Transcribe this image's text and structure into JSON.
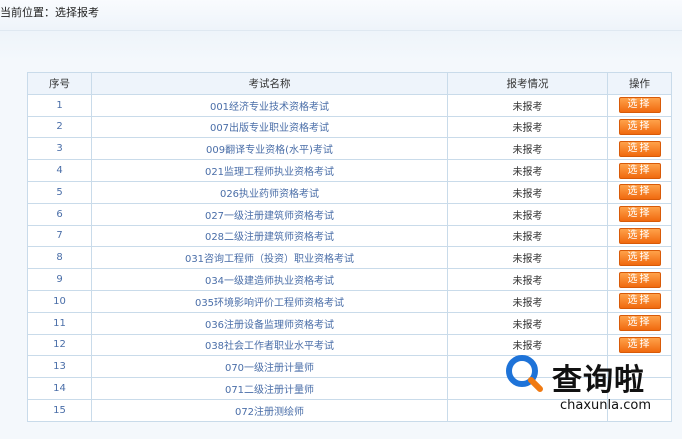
{
  "breadcrumb": "当前位置：选择报考",
  "table": {
    "headers": [
      "序号",
      "考试名称",
      "报考情况",
      "操作"
    ],
    "button_label": "选择",
    "rows": [
      {
        "no": "1",
        "name": "001经济专业技术资格考试",
        "status": "未报考",
        "action": "选择"
      },
      {
        "no": "2",
        "name": "007出版专业职业资格考试",
        "status": "未报考",
        "action": "选择"
      },
      {
        "no": "3",
        "name": "009翻译专业资格(水平)考试",
        "status": "未报考",
        "action": "选择"
      },
      {
        "no": "4",
        "name": "021监理工程师执业资格考试",
        "status": "未报考",
        "action": "选择"
      },
      {
        "no": "5",
        "name": "026执业药师资格考试",
        "status": "未报考",
        "action": "选择"
      },
      {
        "no": "6",
        "name": "027一级注册建筑师资格考试",
        "status": "未报考",
        "action": "选择"
      },
      {
        "no": "7",
        "name": "028二级注册建筑师资格考试",
        "status": "未报考",
        "action": "选择"
      },
      {
        "no": "8",
        "name": "031咨询工程师（投资）职业资格考试",
        "status": "未报考",
        "action": "选择"
      },
      {
        "no": "9",
        "name": "034一级建造师执业资格考试",
        "status": "未报考",
        "action": "选择"
      },
      {
        "no": "10",
        "name": "035环境影响评价工程师资格考试",
        "status": "未报考",
        "action": "选择"
      },
      {
        "no": "11",
        "name": "036注册设备监理师资格考试",
        "status": "未报考",
        "action": "选择"
      },
      {
        "no": "12",
        "name": "038社会工作者职业水平考试",
        "status": "未报考",
        "action": "选择"
      },
      {
        "no": "13",
        "name": "070一级注册计量师",
        "status": "",
        "action": ""
      },
      {
        "no": "14",
        "name": "071二级注册计量师",
        "status": "",
        "action": ""
      },
      {
        "no": "15",
        "name": "072注册测绘师",
        "status": "",
        "action": ""
      }
    ]
  },
  "watermark": {
    "brand_cn": "查询啦",
    "brand_en": "chaxunla.com",
    "colors": {
      "blue": "#1e73d8",
      "orange": "#f07a12"
    }
  }
}
